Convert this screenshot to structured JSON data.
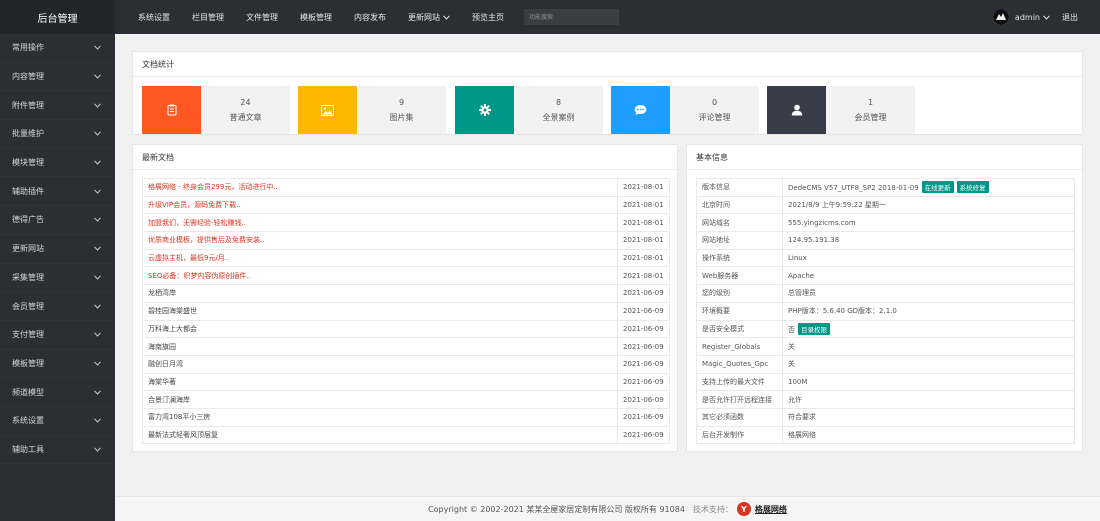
{
  "brand": "后台管理",
  "sidebar": {
    "items": [
      {
        "label": "常用操作"
      },
      {
        "label": "内容管理"
      },
      {
        "label": "附件管理"
      },
      {
        "label": "批量维护"
      },
      {
        "label": "模块管理"
      },
      {
        "label": "辅助插件"
      },
      {
        "label": "德得广告"
      },
      {
        "label": "更新网站"
      },
      {
        "label": "采集管理"
      },
      {
        "label": "会员管理"
      },
      {
        "label": "支付管理"
      },
      {
        "label": "模板管理"
      },
      {
        "label": "频道模型"
      },
      {
        "label": "系统设置"
      },
      {
        "label": "辅助工具"
      }
    ]
  },
  "topnav": {
    "items": [
      {
        "label": "系统设置"
      },
      {
        "label": "栏目管理"
      },
      {
        "label": "文件管理"
      },
      {
        "label": "模板管理"
      },
      {
        "label": "内容发布"
      },
      {
        "label": "更新网站"
      },
      {
        "label": "预览主页"
      }
    ],
    "search_placeholder": "功能搜索"
  },
  "user": {
    "name": "admin",
    "logout": "退出"
  },
  "stats": {
    "title": "文档统计",
    "items": [
      {
        "count": "24",
        "label": "普通文章",
        "color": "#fe5722",
        "icon": "article-icon"
      },
      {
        "count": "9",
        "label": "图片集",
        "color": "#ffb800",
        "icon": "image-icon"
      },
      {
        "count": "8",
        "label": "全景案例",
        "color": "#009688",
        "icon": "gear-icon"
      },
      {
        "count": "0",
        "label": "评论管理",
        "color": "#1e9fff",
        "icon": "comment-icon"
      },
      {
        "count": "1",
        "label": "会员管理",
        "color": "#393d49",
        "icon": "user-icon"
      }
    ]
  },
  "articles": {
    "title": "最新文档",
    "rows": [
      {
        "title": "格展网络 - 终身会员299元，活动进行中..",
        "date": "2021-08-01",
        "hot": true
      },
      {
        "title": "升级VIP会员，源码免费下载..",
        "date": "2021-08-01",
        "hot": true
      },
      {
        "title": "加盟我们，无需经验-轻松赚钱..",
        "date": "2021-08-01",
        "hot": true
      },
      {
        "title": "优质商业模板，提供售后及免费安装..",
        "date": "2021-08-01",
        "hot": true
      },
      {
        "title": "云虚拟主机，最低9元/月..",
        "date": "2021-08-01",
        "hot": true
      },
      {
        "title": "SEO必备：织梦内容伪原创插件..",
        "date": "2021-08-01",
        "hot": true
      },
      {
        "title": "龙栖湾岸",
        "date": "2021-06-09",
        "hot": false
      },
      {
        "title": "碧桂园海棠盛世",
        "date": "2021-06-09",
        "hot": false
      },
      {
        "title": "万科海上大都会",
        "date": "2021-06-09",
        "hot": false
      },
      {
        "title": "海南旗园",
        "date": "2021-06-09",
        "hot": false
      },
      {
        "title": "融创日月湾",
        "date": "2021-06-09",
        "hot": false
      },
      {
        "title": "海棠华著",
        "date": "2021-06-09",
        "hot": false
      },
      {
        "title": "合景汀澜海岸",
        "date": "2021-06-09",
        "hot": false
      },
      {
        "title": "富力湾108平小三房",
        "date": "2021-06-09",
        "hot": false
      },
      {
        "title": "最新法式轻奢风顶层复",
        "date": "2021-06-09",
        "hot": false
      }
    ]
  },
  "info": {
    "title": "基本信息",
    "rows": [
      {
        "key": "版本信息",
        "value": "DedeCMS V57_UTF8_SP2 2018-01-09",
        "tags": [
          "在线更新",
          "系统修复"
        ]
      },
      {
        "key": "北京时间",
        "value": "2021/8/9 上午9:59:22 星期一",
        "tags": []
      },
      {
        "key": "网站域名",
        "value": "555.yingzicms.com",
        "tags": []
      },
      {
        "key": "网站地址",
        "value": "124.95.191.38",
        "tags": []
      },
      {
        "key": "操作系统",
        "value": "Linux",
        "tags": []
      },
      {
        "key": "Web服务器",
        "value": "Apache",
        "tags": []
      },
      {
        "key": "您的级别",
        "value": "总管理员",
        "tags": []
      },
      {
        "key": "环境概要",
        "value": "PHP版本：5.6.40 GD版本：2.1.0",
        "tags": []
      },
      {
        "key": "是否安全模式",
        "value": "否",
        "tags": [
          "目录权限"
        ]
      },
      {
        "key": "Register_Globals",
        "value": "关",
        "tags": []
      },
      {
        "key": "Magic_Quotes_Gpc",
        "value": "关",
        "tags": []
      },
      {
        "key": "支持上传的最大文件",
        "value": "100M",
        "tags": []
      },
      {
        "key": "是否允许打开远程连接",
        "value": "允许",
        "tags": []
      },
      {
        "key": "其它必须函数",
        "value": "符合要求",
        "tags": []
      },
      {
        "key": "后台开发制作",
        "value": "格展网络",
        "tags": []
      }
    ]
  },
  "footer": {
    "copyright": "Copyright © 2002-2021 某某全屋家居定制有限公司 版权所有 91084",
    "support": "技术支持：",
    "logo_text": "格展网络"
  }
}
